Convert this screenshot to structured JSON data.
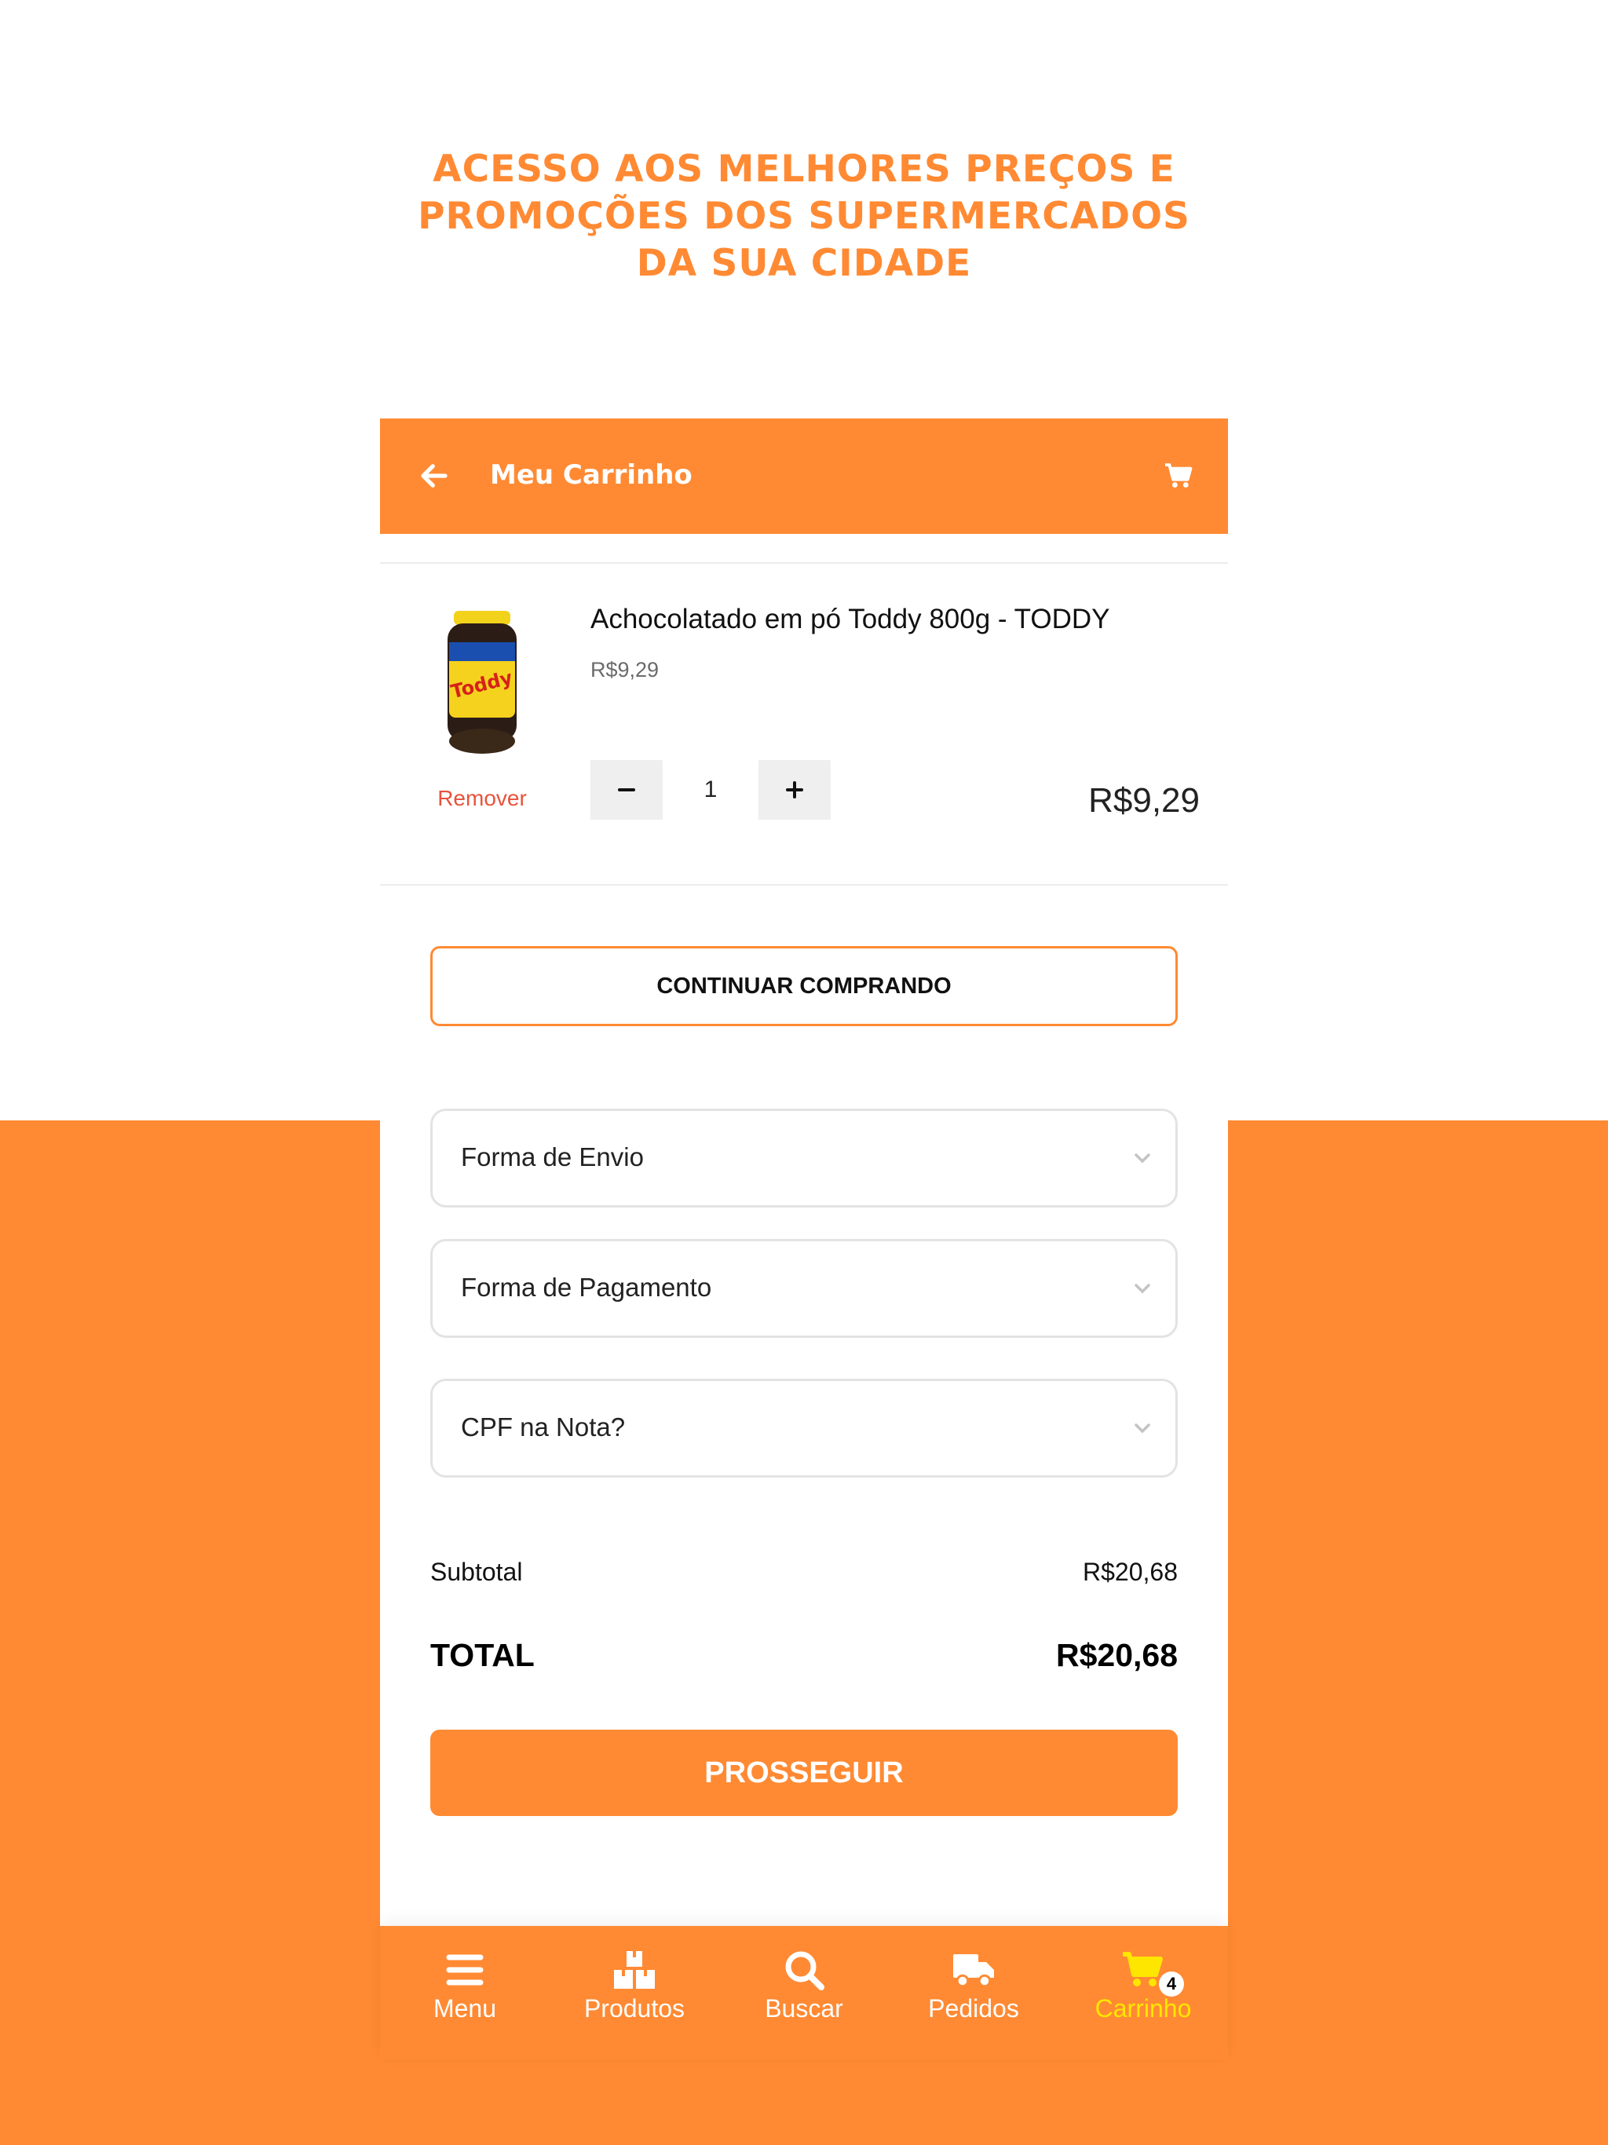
{
  "banner": {
    "lines": [
      "ACESSO AOS MELHORES PREÇOS E",
      "PROMOÇÕES DOS SUPERMERCADOS",
      "DA SUA CIDADE"
    ]
  },
  "header": {
    "title": "Meu Carrinho",
    "back_icon": "arrow-left-icon",
    "cart_icon": "shopping-cart-icon"
  },
  "cart": {
    "items": [
      {
        "name": "Achocolatado em pó Toddy 800g - TODDY",
        "unit_price": "R$9,29",
        "quantity": "1",
        "line_total": "R$9,29",
        "remove_label": "Remover",
        "image": "toddy-jar-image"
      }
    ],
    "continue_label": "CONTINUAR COMPRANDO"
  },
  "checkout": {
    "shipping_placeholder": "Forma de Envio",
    "payment_placeholder": "Forma de Pagamento",
    "cpf_placeholder": "CPF na Nota?",
    "subtotal_label": "Subtotal",
    "subtotal_value": "R$20,68",
    "total_label": "TOTAL",
    "total_value": "R$20,68",
    "proceed_label": "PROSSEGUIR"
  },
  "nav": {
    "items": [
      {
        "label": "Menu",
        "icon": "menu-icon"
      },
      {
        "label": "Produtos",
        "icon": "boxes-icon"
      },
      {
        "label": "Buscar",
        "icon": "search-icon"
      },
      {
        "label": "Pedidos",
        "icon": "truck-icon"
      },
      {
        "label": "Carrinho",
        "icon": "cart-icon",
        "badge": "4",
        "active": true
      }
    ]
  },
  "colors": {
    "brand_orange": "#ff8a33",
    "active_nav": "#ffe600",
    "remove_red": "#e8533b"
  }
}
